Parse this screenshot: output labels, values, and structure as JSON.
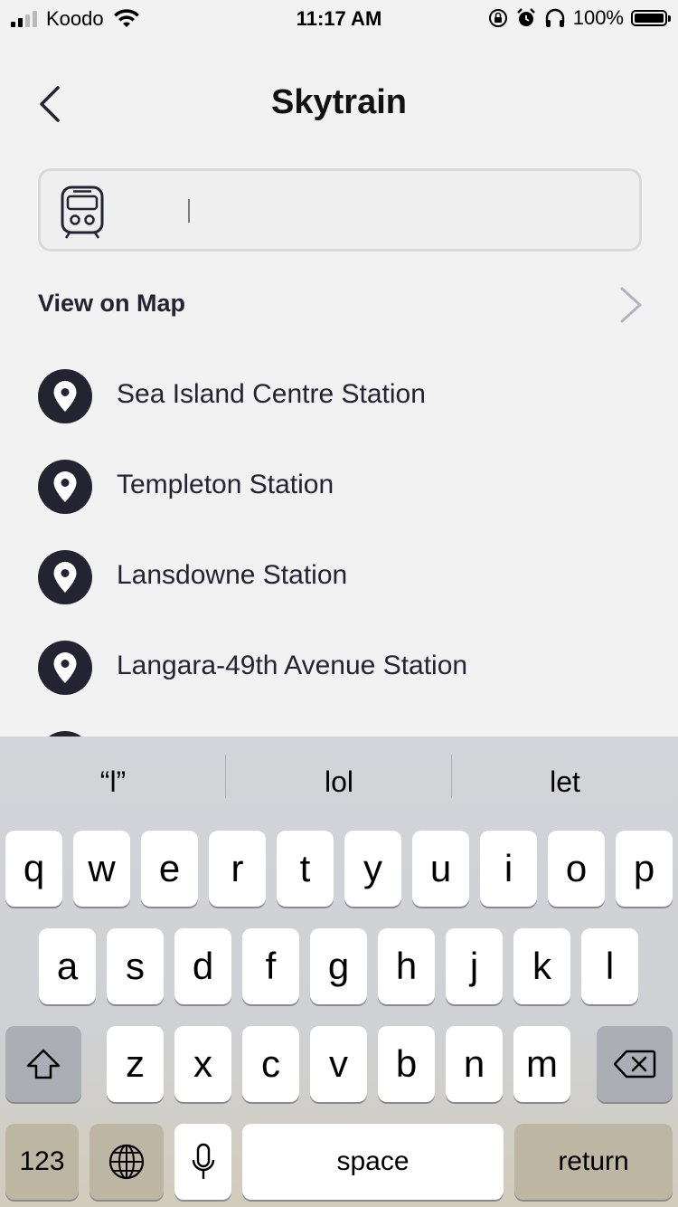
{
  "status_bar": {
    "carrier": "Koodo",
    "time": "11:17 AM",
    "battery": "100%"
  },
  "header": {
    "back_icon": "chevron-left-icon",
    "title": "Skytrain"
  },
  "search": {
    "icon": "train-icon",
    "value": "",
    "placeholder": ""
  },
  "view_map": {
    "label": "View on Map",
    "icon": "chevron-right-icon"
  },
  "stations": [
    {
      "label": "Sea Island Centre Station",
      "icon": "map-pin-icon"
    },
    {
      "label": "Templeton Station",
      "icon": "map-pin-icon"
    },
    {
      "label": "Lansdowne Station",
      "icon": "map-pin-icon"
    },
    {
      "label": "Langara-49th Avenue Station",
      "icon": "map-pin-icon"
    }
  ],
  "keyboard": {
    "suggestions": [
      "“l”",
      "lol",
      "let"
    ],
    "row1": [
      "q",
      "w",
      "e",
      "r",
      "t",
      "y",
      "u",
      "i",
      "o",
      "p"
    ],
    "row2": [
      "a",
      "s",
      "d",
      "f",
      "g",
      "h",
      "j",
      "k",
      "l"
    ],
    "row3": [
      "z",
      "x",
      "c",
      "v",
      "b",
      "n",
      "m"
    ],
    "numbers_label": "123",
    "space_label": "space",
    "return_label": "return"
  },
  "colors": {
    "background": "#f2f2f2",
    "primary_dark": "#232332",
    "chevron": "#b3b3c4"
  }
}
